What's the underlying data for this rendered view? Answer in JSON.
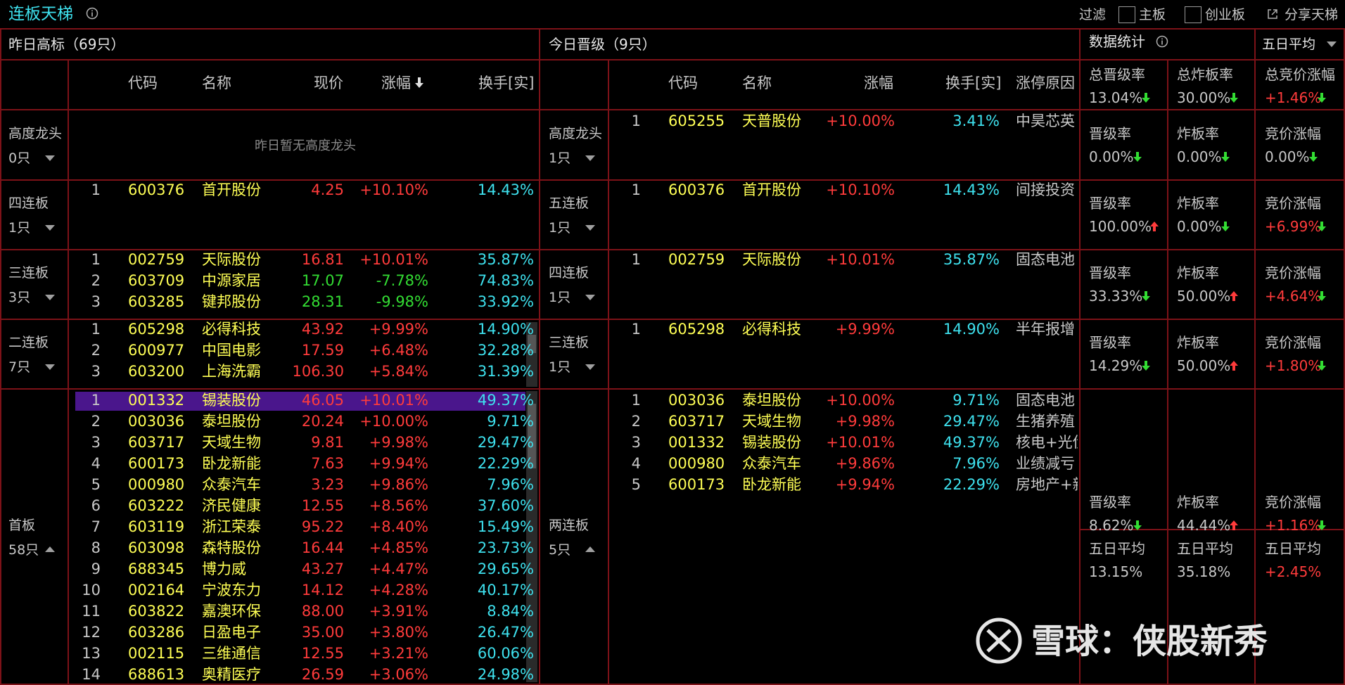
{
  "header": {
    "title": "连板天梯",
    "filter_label": "过滤",
    "main_board": "主板",
    "growth_board": "创业板",
    "share": "分享天梯"
  },
  "left": {
    "title": "昨日高标（69只）",
    "cols": [
      "代码",
      "名称",
      "现价",
      "涨幅",
      "换手[实]"
    ],
    "empty_msg": "昨日暂无高度龙头",
    "groups": [
      {
        "name": "高度龙头",
        "count": "0只"
      },
      {
        "name": "四连板",
        "count": "1只"
      },
      {
        "name": "三连板",
        "count": "3只"
      },
      {
        "name": "二连板",
        "count": "7只"
      },
      {
        "name": "首板",
        "count": "58只"
      }
    ],
    "g4": [
      [
        "1",
        "600376",
        "首开股份",
        "4.25",
        "+10.10%",
        "14.43%"
      ]
    ],
    "g3": [
      [
        "1",
        "002759",
        "天际股份",
        "16.81",
        "+10.01%",
        "35.87%"
      ],
      [
        "2",
        "603709",
        "中源家居",
        "17.07",
        "-7.78%",
        "74.83%"
      ],
      [
        "3",
        "603285",
        "键邦股份",
        "28.31",
        "-9.98%",
        "33.92%"
      ]
    ],
    "g2": [
      [
        "1",
        "605298",
        "必得科技",
        "43.92",
        "+9.99%",
        "14.90%"
      ],
      [
        "2",
        "600977",
        "中国电影",
        "17.59",
        "+6.48%",
        "32.28%"
      ],
      [
        "3",
        "603200",
        "上海洗霸",
        "106.30",
        "+5.84%",
        "31.39%"
      ]
    ],
    "g1": [
      [
        "1",
        "001332",
        "锡装股份",
        "46.05",
        "+10.01%",
        "49.37%"
      ],
      [
        "2",
        "003036",
        "泰坦股份",
        "20.24",
        "+10.00%",
        "9.71%"
      ],
      [
        "3",
        "603717",
        "天域生物",
        "9.81",
        "+9.98%",
        "29.47%"
      ],
      [
        "4",
        "600173",
        "卧龙新能",
        "7.63",
        "+9.94%",
        "22.29%"
      ],
      [
        "5",
        "000980",
        "众泰汽车",
        "3.23",
        "+9.86%",
        "7.96%"
      ],
      [
        "6",
        "603222",
        "济民健康",
        "12.55",
        "+8.56%",
        "37.60%"
      ],
      [
        "7",
        "603119",
        "浙江荣泰",
        "95.22",
        "+8.40%",
        "15.49%"
      ],
      [
        "8",
        "603098",
        "森特股份",
        "16.44",
        "+4.85%",
        "23.73%"
      ],
      [
        "9",
        "688345",
        "博力威",
        "43.27",
        "+4.47%",
        "29.65%"
      ],
      [
        "10",
        "002164",
        "宁波东力",
        "14.12",
        "+4.28%",
        "40.17%"
      ],
      [
        "11",
        "603822",
        "嘉澳环保",
        "88.00",
        "+3.91%",
        "8.84%"
      ],
      [
        "12",
        "603286",
        "日盈电子",
        "35.00",
        "+3.80%",
        "26.47%"
      ],
      [
        "13",
        "002115",
        "三维通信",
        "12.55",
        "+3.21%",
        "60.06%"
      ],
      [
        "14",
        "688613",
        "奥精医疗",
        "26.59",
        "+3.06%",
        "24.98%"
      ]
    ]
  },
  "mid": {
    "title": "今日晋级（9只）",
    "cols": [
      "代码",
      "名称",
      "涨幅",
      "换手[实]",
      "涨停原因"
    ],
    "groups": [
      {
        "name": "高度龙头",
        "count": "1只"
      },
      {
        "name": "五连板",
        "count": "1只"
      },
      {
        "name": "四连板",
        "count": "1只"
      },
      {
        "name": "三连板",
        "count": "1只"
      },
      {
        "name": "两连板",
        "count": "5只"
      }
    ],
    "g0": [
      [
        "1",
        "605255",
        "天普股份",
        "+10.00%",
        "3.41%",
        "中昊芯英"
      ]
    ],
    "g5": [
      [
        "1",
        "600376",
        "首开股份",
        "+10.10%",
        "14.43%",
        "间接投资"
      ]
    ],
    "g4": [
      [
        "1",
        "002759",
        "天际股份",
        "+10.01%",
        "35.87%",
        "固态电池"
      ]
    ],
    "g3": [
      [
        "1",
        "605298",
        "必得科技",
        "+9.99%",
        "14.90%",
        "半年报增"
      ]
    ],
    "g2": [
      [
        "1",
        "003036",
        "泰坦股份",
        "+10.00%",
        "9.71%",
        "固态电池"
      ],
      [
        "2",
        "603717",
        "天域生物",
        "+9.98%",
        "29.47%",
        "生猪养殖"
      ],
      [
        "3",
        "001332",
        "锡装股份",
        "+10.01%",
        "49.37%",
        "核电+光伏"
      ],
      [
        "4",
        "000980",
        "众泰汽车",
        "+9.86%",
        "7.96%",
        "业绩减亏"
      ],
      [
        "5",
        "600173",
        "卧龙新能",
        "+9.94%",
        "22.29%",
        "房地产+新"
      ]
    ]
  },
  "stats": {
    "title": "数据统计",
    "dropdown": "五日平均",
    "total": {
      "l1": "总晋级率",
      "v1": "13.04%",
      "l2": "总炸板率",
      "v2": "30.00%",
      "l3": "总竞价涨幅",
      "v3": "+1.46%"
    },
    "rows": [
      {
        "l1": "晋级率",
        "v1": "0.00%",
        "l2": "炸板率",
        "v2": "0.00%",
        "l3": "竞价涨幅",
        "v3": "0.00%"
      },
      {
        "l1": "晋级率",
        "v1": "100.00%",
        "l2": "炸板率",
        "v2": "0.00%",
        "l3": "竞价涨幅",
        "v3": "+6.99%"
      },
      {
        "l1": "晋级率",
        "v1": "33.33%",
        "l2": "炸板率",
        "v2": "50.00%",
        "l3": "竞价涨幅",
        "v3": "+4.64%"
      },
      {
        "l1": "晋级率",
        "v1": "14.29%",
        "l2": "炸板率",
        "v2": "50.00%",
        "l3": "竞价涨幅",
        "v3": "+1.80%"
      },
      {
        "l1": "晋级率",
        "v1": "8.62%",
        "l2": "炸板率",
        "v2": "44.44%",
        "l3": "竞价涨幅",
        "v3": "+1.16%"
      }
    ],
    "avg": {
      "label": "五日平均",
      "v1": "13.15%",
      "v2": "35.18%",
      "v3": "+2.45%"
    }
  },
  "watermark": "雪球：侠股新秀",
  "colors": {
    "border": "#7d1218",
    "code": "#ffff55",
    "up": "#ff3b3b",
    "down": "#33dd33",
    "turnover": "#3ee1ee",
    "highlight": "#4a168c"
  }
}
